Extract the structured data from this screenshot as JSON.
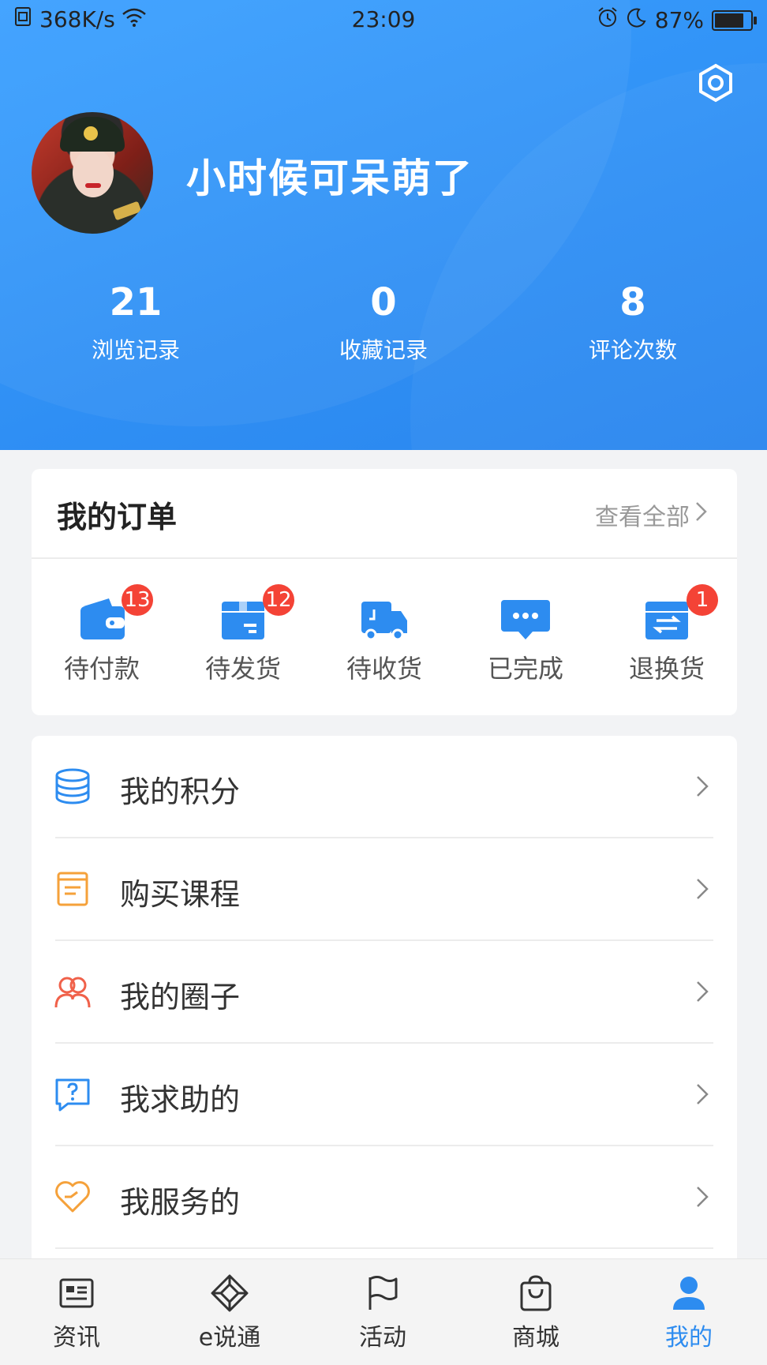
{
  "status_bar": {
    "speed": "368K/s",
    "time": "23:09",
    "battery": "87%"
  },
  "profile": {
    "username": "小时候可呆萌了",
    "stats": [
      {
        "value": "21",
        "label": "浏览记录"
      },
      {
        "value": "0",
        "label": "收藏记录"
      },
      {
        "value": "8",
        "label": "评论次数"
      }
    ]
  },
  "orders": {
    "title": "我的订单",
    "view_all": "查看全部",
    "items": [
      {
        "label": "待付款",
        "count": "13",
        "icon": "wallet-icon"
      },
      {
        "label": "待发货",
        "count": "12",
        "icon": "package-icon"
      },
      {
        "label": "待收货",
        "count": "",
        "icon": "truck-icon"
      },
      {
        "label": "已完成",
        "count": "",
        "icon": "chat-bubble-icon"
      },
      {
        "label": "退换货",
        "count": "1",
        "icon": "exchange-box-icon"
      }
    ]
  },
  "menu": [
    {
      "label": "我的积分",
      "icon": "coins-stack-icon",
      "color": "#2d8cf0"
    },
    {
      "label": "购买课程",
      "icon": "book-icon",
      "color": "#f5a13a"
    },
    {
      "label": "我的圈子",
      "icon": "group-icon",
      "color": "#f0614a"
    },
    {
      "label": "我求助的",
      "icon": "question-chat-icon",
      "color": "#2d8cf0"
    },
    {
      "label": "我服务的",
      "icon": "heart-icon",
      "color": "#f5a13a"
    }
  ],
  "tabs": [
    {
      "label": "资讯",
      "icon": "news-icon"
    },
    {
      "label": "e说通",
      "icon": "compass-diamond-icon"
    },
    {
      "label": "活动",
      "icon": "flag-icon"
    },
    {
      "label": "商城",
      "icon": "shopping-bag-icon"
    },
    {
      "label": "我的",
      "icon": "user-icon",
      "active": true
    }
  ],
  "colors": {
    "accent": "#2d8cf0",
    "header_blue": "#3198f8",
    "badge_red": "#f44336"
  }
}
